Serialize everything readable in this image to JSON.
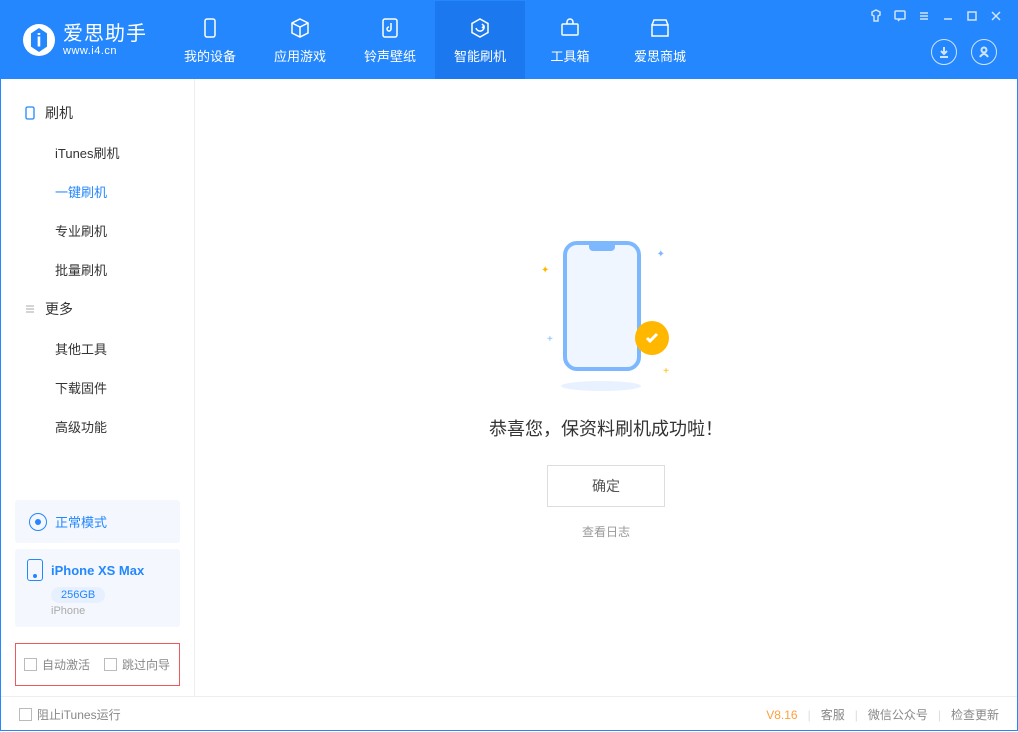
{
  "app": {
    "name": "爱思助手",
    "url": "www.i4.cn"
  },
  "nav": {
    "items": [
      {
        "label": "我的设备"
      },
      {
        "label": "应用游戏"
      },
      {
        "label": "铃声壁纸"
      },
      {
        "label": "智能刷机"
      },
      {
        "label": "工具箱"
      },
      {
        "label": "爱思商城"
      }
    ]
  },
  "sidebar": {
    "group1_title": "刷机",
    "group1_items": [
      {
        "label": "iTunes刷机"
      },
      {
        "label": "一键刷机"
      },
      {
        "label": "专业刷机"
      },
      {
        "label": "批量刷机"
      }
    ],
    "group2_title": "更多",
    "group2_items": [
      {
        "label": "其他工具"
      },
      {
        "label": "下载固件"
      },
      {
        "label": "高级功能"
      }
    ],
    "mode_label": "正常模式",
    "device_name": "iPhone XS Max",
    "device_storage": "256GB",
    "device_type": "iPhone",
    "opt_auto_activate": "自动激活",
    "opt_skip_guide": "跳过向导"
  },
  "main": {
    "success_text": "恭喜您，保资料刷机成功啦！",
    "ok_button": "确定",
    "view_log": "查看日志"
  },
  "footer": {
    "block_itunes": "阻止iTunes运行",
    "version": "V8.16",
    "links": [
      {
        "label": "客服"
      },
      {
        "label": "微信公众号"
      },
      {
        "label": "检查更新"
      }
    ]
  }
}
